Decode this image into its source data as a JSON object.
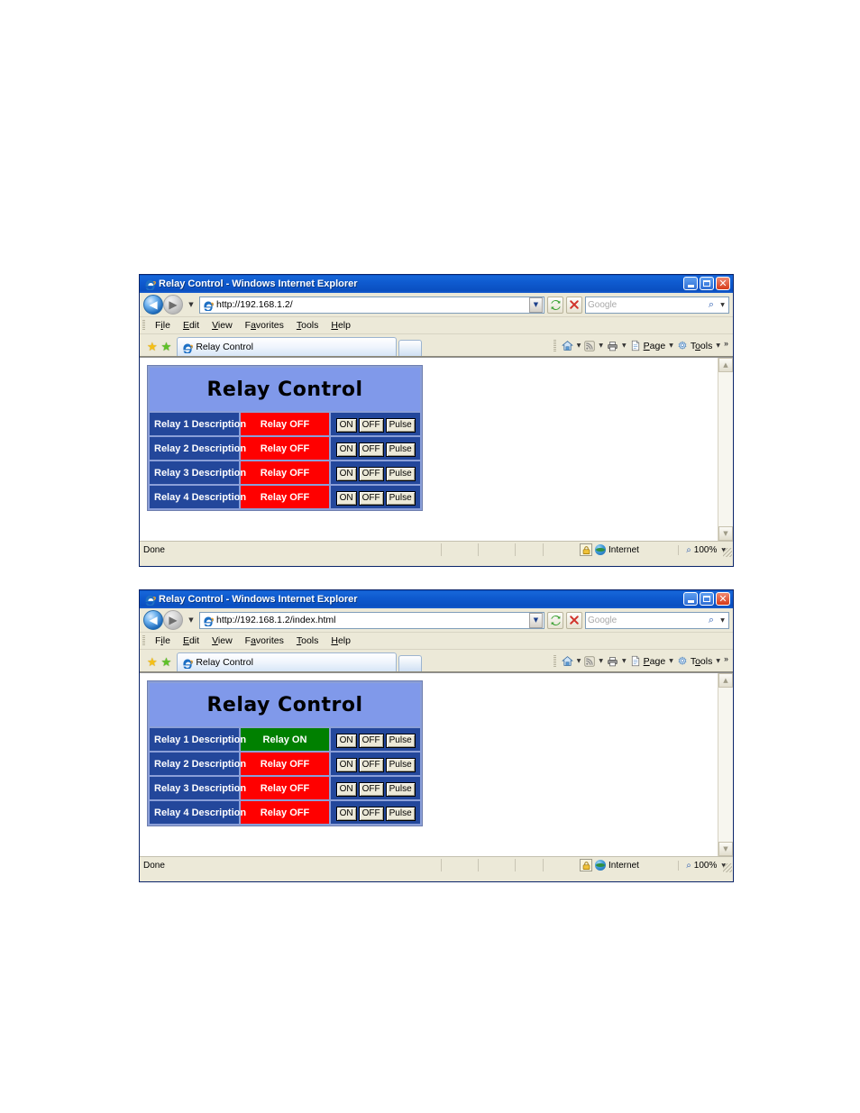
{
  "windows": [
    {
      "title": "Relay Control - Windows Internet Explorer",
      "url": "http://192.168.1.2/",
      "search_placeholder": "Google",
      "tab_label": "Relay Control",
      "menu": [
        {
          "pre": "F",
          "acc": "i",
          "post": "le"
        },
        {
          "pre": "",
          "acc": "E",
          "post": "dit"
        },
        {
          "pre": "",
          "acc": "V",
          "post": "iew"
        },
        {
          "pre": "F",
          "acc": "a",
          "post": "vorites"
        },
        {
          "pre": "",
          "acc": "T",
          "post": "ools"
        },
        {
          "pre": "",
          "acc": "H",
          "post": "elp"
        }
      ],
      "commands": {
        "home": "home-icon",
        "feeds": "rss-feed-icon",
        "print": "print-icon",
        "page_label": "Page",
        "page_acc": "P",
        "tools_label": "Tools",
        "tools_acc": "o",
        "overflow": "»"
      },
      "page": {
        "heading": "Relay Control",
        "rows": [
          {
            "description": "Relay 1 Description",
            "state": "Relay OFF",
            "state_on": false,
            "buttons": [
              "ON",
              "OFF",
              "Pulse"
            ]
          },
          {
            "description": "Relay 2 Description",
            "state": "Relay OFF",
            "state_on": false,
            "buttons": [
              "ON",
              "OFF",
              "Pulse"
            ]
          },
          {
            "description": "Relay 3 Description",
            "state": "Relay OFF",
            "state_on": false,
            "buttons": [
              "ON",
              "OFF",
              "Pulse"
            ]
          },
          {
            "description": "Relay 4 Description",
            "state": "Relay OFF",
            "state_on": false,
            "buttons": [
              "ON",
              "OFF",
              "Pulse"
            ]
          }
        ]
      },
      "status": {
        "message": "Done",
        "zone": "Internet",
        "zoom": "100%"
      }
    },
    {
      "title": "Relay Control - Windows Internet Explorer",
      "url": "http://192.168.1.2/index.html",
      "search_placeholder": "Google",
      "tab_label": "Relay Control",
      "menu": [
        {
          "pre": "F",
          "acc": "i",
          "post": "le"
        },
        {
          "pre": "",
          "acc": "E",
          "post": "dit"
        },
        {
          "pre": "",
          "acc": "V",
          "post": "iew"
        },
        {
          "pre": "F",
          "acc": "a",
          "post": "vorites"
        },
        {
          "pre": "",
          "acc": "T",
          "post": "ools"
        },
        {
          "pre": "",
          "acc": "H",
          "post": "elp"
        }
      ],
      "commands": {
        "home": "home-icon",
        "feeds": "rss-feed-icon",
        "print": "print-icon",
        "page_label": "Page",
        "page_acc": "P",
        "tools_label": "Tools",
        "tools_acc": "o",
        "overflow": "»"
      },
      "page": {
        "heading": "Relay Control",
        "rows": [
          {
            "description": "Relay 1 Description",
            "state": "Relay ON",
            "state_on": true,
            "buttons": [
              "ON",
              "OFF",
              "Pulse"
            ]
          },
          {
            "description": "Relay 2 Description",
            "state": "Relay OFF",
            "state_on": false,
            "buttons": [
              "ON",
              "OFF",
              "Pulse"
            ]
          },
          {
            "description": "Relay 3 Description",
            "state": "Relay OFF",
            "state_on": false,
            "buttons": [
              "ON",
              "OFF",
              "Pulse"
            ]
          },
          {
            "description": "Relay 4 Description",
            "state": "Relay OFF",
            "state_on": false,
            "buttons": [
              "ON",
              "OFF",
              "Pulse"
            ]
          }
        ]
      },
      "status": {
        "message": "Done",
        "zone": "Internet",
        "zoom": "100%"
      }
    }
  ],
  "colors": {
    "titlebar_blue": "#0f5bd0",
    "relay_header_bg": "#8099ea",
    "relay_desc_bg": "#23479b",
    "state_off_bg": "#ff0000",
    "state_on_bg": "#008000",
    "table_frame": "#8b9fd8",
    "chrome_bg": "#ece9d8"
  }
}
